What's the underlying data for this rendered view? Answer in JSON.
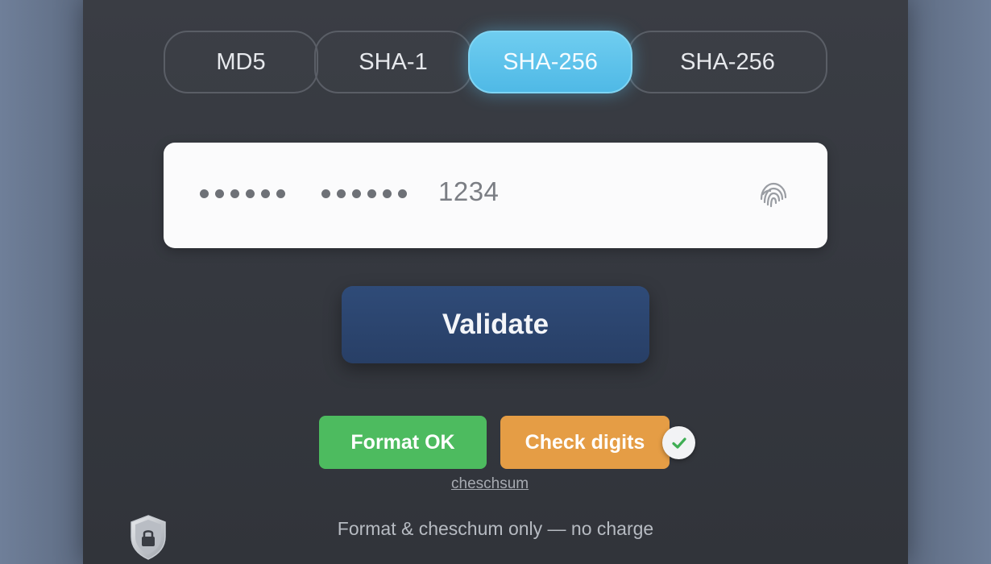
{
  "tabs": [
    {
      "label": "MD5",
      "active": false
    },
    {
      "label": "SHA-1",
      "active": false
    },
    {
      "label": "SHA-256",
      "active": true
    },
    {
      "label": "SHA-256",
      "active": false
    }
  ],
  "card_input": {
    "masked_group_1": "••••••",
    "masked_group_2": "••••••",
    "last_digits": "1234",
    "trailing_icon": "fingerprint-icon"
  },
  "validate_button": {
    "label": "Validate"
  },
  "status": {
    "format_badge": "Format OK",
    "check_badge": "Check digits",
    "check_icon": "checkmark-icon"
  },
  "checksum_link": "cheschsum",
  "footer_note": "Format & cheschum only — no charge",
  "colors": {
    "active_tab": "#5bc2ea",
    "validate": "#2c4572",
    "format_ok": "#4dbb5f",
    "check_digits": "#e59d45"
  }
}
